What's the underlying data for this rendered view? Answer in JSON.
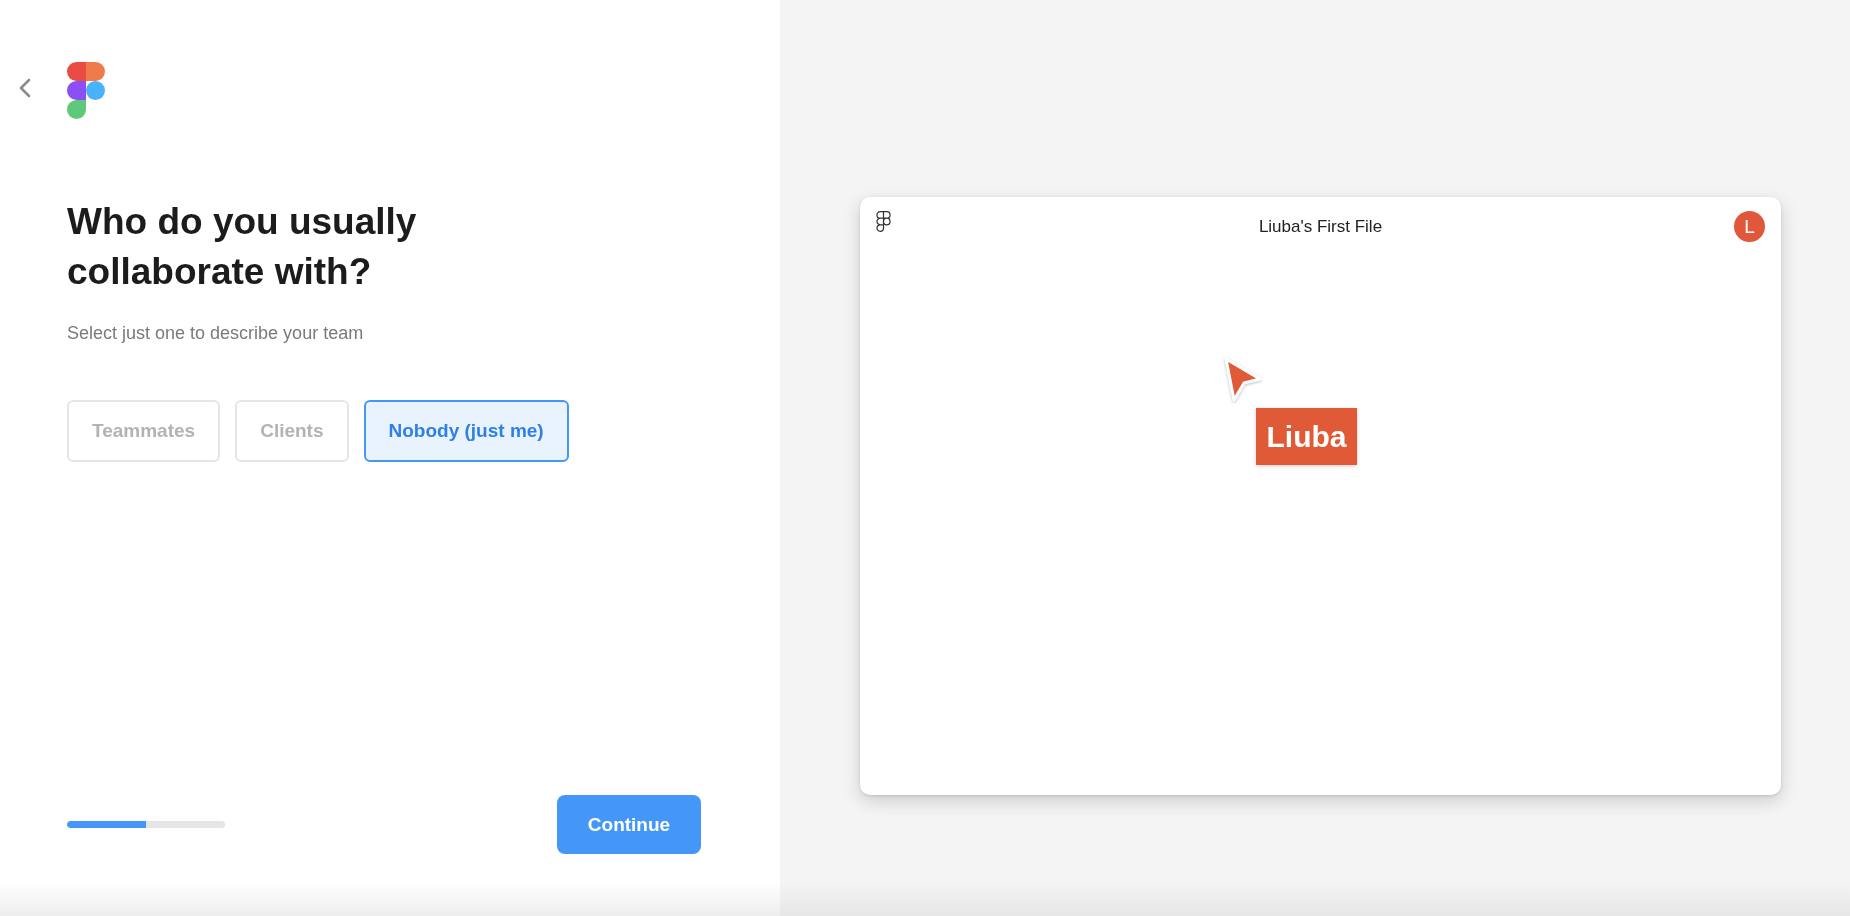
{
  "heading": "Who do you usually collaborate with?",
  "subtitle": "Select just one to describe your team",
  "options": [
    {
      "label": "Teammates",
      "selected": false
    },
    {
      "label": "Clients",
      "selected": false
    },
    {
      "label": "Nobody (just me)",
      "selected": true
    }
  ],
  "progress": {
    "level": 0.5
  },
  "continue_button": "Continue",
  "preview": {
    "file_title": "Liuba's First File",
    "avatar_initial": "L",
    "cursor_label": "Liuba"
  }
}
